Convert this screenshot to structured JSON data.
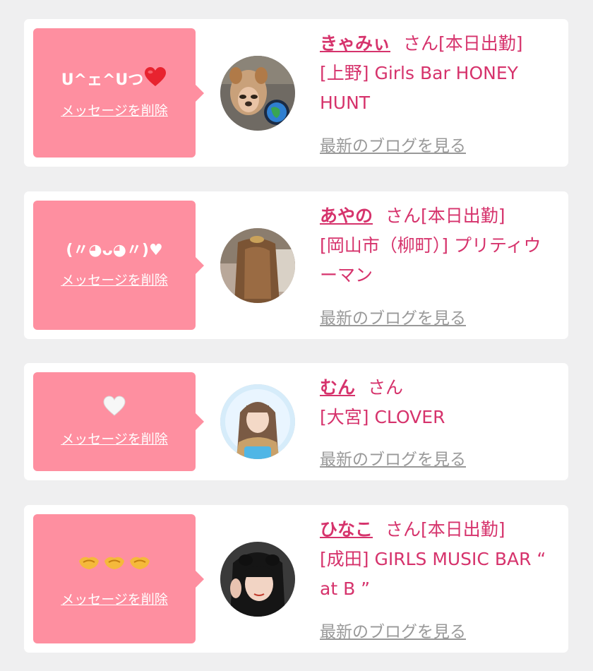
{
  "cards": [
    {
      "message": "U^ェ^Uつ",
      "message_icon": "red-heart-icon",
      "delete_label": "メッセージを削除",
      "name": "きゃみぃ",
      "status": "さん[本日出勤]",
      "shop": "[上野] Girls Bar HONEY HUNT",
      "blog_label": "最新のブログを見る"
    },
    {
      "message": "(〃◕ᴗ◕〃)♥",
      "delete_label": "メッセージを削除",
      "name": "あやの",
      "status": "さん[本日出勤]",
      "shop": "[岡山市（柳町）] プリティウーマン",
      "blog_label": "最新のブログを見る"
    },
    {
      "message_icon": "white-heart-icon",
      "delete_label": "メッセージを削除",
      "name": "むん",
      "status": "さん",
      "shop": "[大宮] CLOVER",
      "blog_label": "最新のブログを見る"
    },
    {
      "message_icon": "handshake-icons",
      "delete_label": "メッセージを削除",
      "name": "ひなこ",
      "status": "さん[本日出勤]",
      "shop": "[成田] GIRLS MUSIC BAR “ at B ”",
      "blog_label": "最新のブログを見る"
    }
  ],
  "colors": {
    "background": "#efeff0",
    "bubble": "#fe8fa0",
    "accent": "#d6336c",
    "link_gray": "#999999"
  }
}
